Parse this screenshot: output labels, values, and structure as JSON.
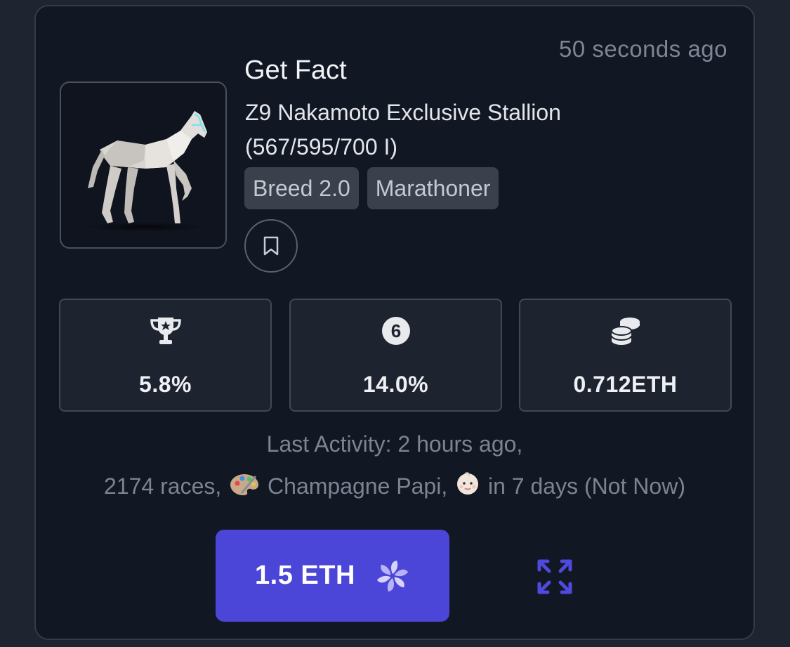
{
  "listing": {
    "timestamp": "50 seconds ago",
    "name": "Get Fact",
    "description_line1": "Z9 Nakamoto Exclusive Stallion",
    "description_line2": "(567/595/700 I)",
    "badges": [
      "Breed 2.0",
      "Marathoner"
    ]
  },
  "stats": [
    {
      "icon": "trophy-icon",
      "value": "5.8%"
    },
    {
      "icon": "number-six-icon",
      "value": "14.0%"
    },
    {
      "icon": "coins-icon",
      "value": "0.712ETH"
    }
  ],
  "activity": {
    "line1": "Last Activity: 2 hours ago,",
    "races": "2174 races,",
    "stable": "Champagne Papi,",
    "breeding": "in 7 days (Not Now)"
  },
  "actions": {
    "price": "1.5 ETH",
    "buy_icon": "pinwheel-icon",
    "expand_icon": "expand-icon"
  },
  "colors": {
    "background": "#1f2431",
    "card": "#121724",
    "accent": "#4b45d8",
    "muted_text": "#7d8391"
  }
}
